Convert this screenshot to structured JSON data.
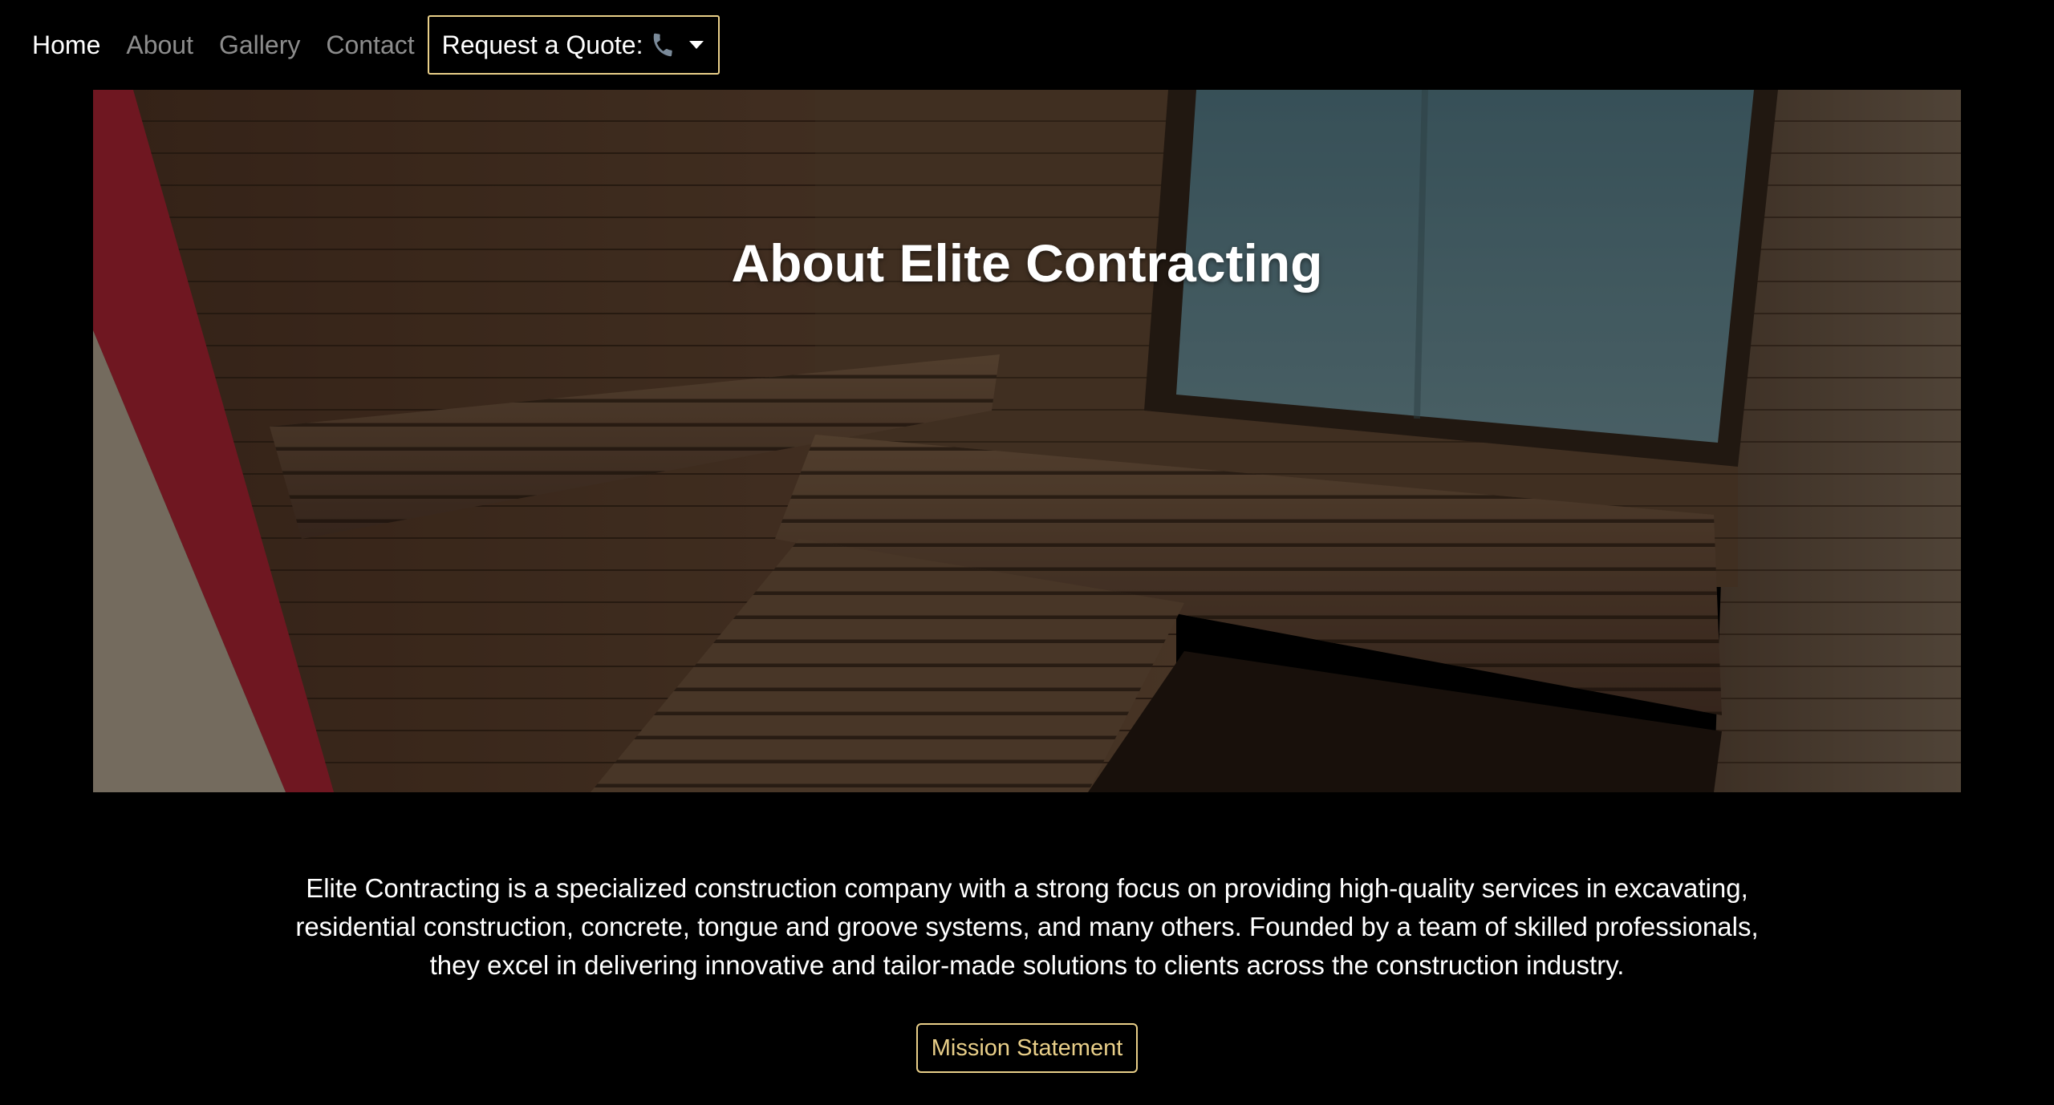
{
  "nav": {
    "links": [
      {
        "label": "Home",
        "active": true
      },
      {
        "label": "About",
        "active": false
      },
      {
        "label": "Gallery",
        "active": false
      },
      {
        "label": "Contact",
        "active": false
      }
    ],
    "quote_label": "Request a Quote:",
    "quote_icon": "phone-icon",
    "dropdown_icon": "caret-down-icon"
  },
  "hero": {
    "title": "About Elite Contracting",
    "image": "sauna-interior-wood-benches"
  },
  "about": {
    "paragraph": "Elite Contracting is a specialized construction company with a strong focus on providing high-quality services in excavating, residential construction, concrete, tongue and groove systems, and many others. Founded by a team of skilled professionals, they excel in delivering innovative and tailor-made solutions to clients across the construction industry."
  },
  "mission_button": {
    "label": "Mission Statement"
  },
  "colors": {
    "background": "#000000",
    "accent": "#e9cf89",
    "nav_inactive": "#8c8c8c",
    "text": "#ffffff"
  }
}
